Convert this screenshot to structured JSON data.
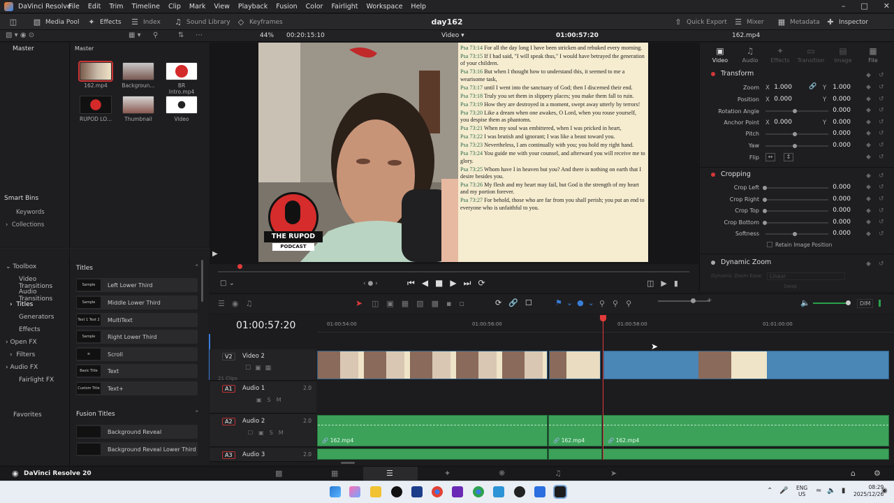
{
  "app": {
    "name": "DaVinci Resolve",
    "project": "day162",
    "version_label": "DaVinci Resolve 20"
  },
  "menu": [
    "File",
    "Edit",
    "Trim",
    "Timeline",
    "Clip",
    "Mark",
    "View",
    "Playback",
    "Fusion",
    "Color",
    "Fairlight",
    "Workspace",
    "Help"
  ],
  "toolbar": {
    "left": [
      "Media Pool",
      "Effects",
      "Index",
      "Sound Library",
      "Keyframes"
    ],
    "right": [
      "Quick Export",
      "Mixer",
      "Metadata",
      "Inspector"
    ]
  },
  "viewer_bar": {
    "zoom": "44%",
    "source_tc": "00:20:15:10",
    "mode": "Video",
    "record_tc": "01:00:57:20",
    "clip_name": "162.mp4"
  },
  "media_pool": {
    "bin_label": "Master",
    "breadcrumb": "Master",
    "clips": [
      "162.mp4",
      "Backgroun...",
      "BR Intro.mp4",
      "RUPOD LO...",
      "Thumbnail",
      "Video"
    ],
    "smart_bins_title": "Smart Bins",
    "smart_bins": [
      "Keywords",
      "Collections"
    ]
  },
  "effects_tree": [
    "Toolbox",
    "Video Transitions",
    "Audio Transitions",
    "Titles",
    "Generators",
    "Effects",
    "Open FX",
    "Filters",
    "Audio FX",
    "Fairlight FX",
    "Favorites"
  ],
  "titles": {
    "header": "Titles",
    "items": [
      {
        "label": "Left Lower Third",
        "thumb": "Sample"
      },
      {
        "label": "Middle Lower Third",
        "thumb": "Sample"
      },
      {
        "label": "MultiText",
        "thumb": "Text 1 Text 2"
      },
      {
        "label": "Right Lower Third",
        "thumb": "Sample"
      },
      {
        "label": "Scroll",
        "thumb": ""
      },
      {
        "label": "Text",
        "thumb": "Basic Title"
      },
      {
        "label": "Text+",
        "thumb": "Custom Title"
      }
    ],
    "fusion_header": "Fusion Titles",
    "fusion_items": [
      "Background Reveal",
      "Background Reveal Lower Third"
    ]
  },
  "logo": {
    "line1": "THE RUPOD",
    "line2": "PODCAST"
  },
  "scripture": [
    {
      "ref": "Psa 73:14",
      "text": "For all the day long I have been stricken and rebuked every morning."
    },
    {
      "ref": "Psa 73:15",
      "text": "If I had said, \"I will speak thus,\" I would have betrayed the generation of your children."
    },
    {
      "ref": "Psa 73:16",
      "text": "But when I thought how to understand this, it seemed to me a wearisome task,"
    },
    {
      "ref": "Psa 73:17",
      "text": "until I went into the sanctuary of God; then I discerned their end."
    },
    {
      "ref": "Psa 73:18",
      "text": "Truly you set them in slippery places; you make them fall to ruin."
    },
    {
      "ref": "Psa 73:19",
      "text": "How they are destroyed in a moment, swept away utterly by terrors!"
    },
    {
      "ref": "Psa 73:20",
      "text": "Like a dream when one awakes, O Lord, when you rouse yourself, you despise them as phantoms."
    },
    {
      "ref": "Psa 73:21",
      "text": "When my soul was embittered, when I was pricked in heart,"
    },
    {
      "ref": "Psa 73:22",
      "text": "I was brutish and ignorant; I was like a beast toward you."
    },
    {
      "ref": "Psa 73:23",
      "text": "Nevertheless, I am continually with you; you hold my right hand."
    },
    {
      "ref": "Psa 73:24",
      "text": "You guide me with your counsel, and afterward you will receive me to glory."
    },
    {
      "ref": "Psa 73:25",
      "text": "Whom have I in heaven but you? And there is nothing on earth that I desire besides you."
    },
    {
      "ref": "Psa 73:26",
      "text": "My flesh and my heart may fail, but God is the strength of my heart and my portion forever."
    },
    {
      "ref": "Psa 73:27",
      "text": "For behold, those who are far from you shall perish; you put an end to everyone who is unfaithful to you."
    }
  ],
  "inspector": {
    "tabs": [
      "Video",
      "Audio",
      "Effects",
      "Transition",
      "Image",
      "File"
    ],
    "transform": {
      "title": "Transform",
      "zoom_label": "Zoom",
      "zoom_x": "1.000",
      "zoom_y": "1.000",
      "position_label": "Position",
      "position_x": "0.000",
      "position_y": "0.000",
      "rotation_label": "Rotation Angle",
      "rotation": "0.000",
      "anchor_label": "Anchor Point",
      "anchor_x": "0.000",
      "anchor_y": "0.000",
      "pitch_label": "Pitch",
      "pitch": "0.000",
      "yaw_label": "Yaw",
      "yaw": "0.000",
      "flip_label": "Flip"
    },
    "cropping": {
      "title": "Cropping",
      "rows": [
        {
          "label": "Crop Left",
          "value": "0.000"
        },
        {
          "label": "Crop Right",
          "value": "0.000"
        },
        {
          "label": "Crop Top",
          "value": "0.000"
        },
        {
          "label": "Crop Bottom",
          "value": "0.000"
        },
        {
          "label": "Softness",
          "value": "0.000"
        }
      ],
      "retain": "Retain Image Position"
    },
    "dynamic_zoom": {
      "title": "Dynamic Zoom",
      "ease_label": "Dynamic Zoom Ease",
      "ease_value": "Linear",
      "swap": "Swap"
    }
  },
  "timeline": {
    "timecode": "01:00:57:20",
    "ruler": [
      "01:00:54:00",
      "01:00:56:00",
      "01:00:58:00",
      "01:01:00:00"
    ],
    "tracks": [
      {
        "id": "V2",
        "name": "Video 2",
        "sub": "21 Clips"
      },
      {
        "id": "A1",
        "name": "Audio 1",
        "vol": "2.0"
      },
      {
        "id": "A2",
        "name": "Audio 2",
        "vol": "2.0"
      },
      {
        "id": "A3",
        "name": "Audio 3",
        "vol": "2.0"
      }
    ],
    "audio_clips": [
      "162.mp4",
      "162.mp4",
      "162.mp4"
    ],
    "dim": "DIM"
  },
  "taskbar": {
    "lang1": "ENG",
    "lang2": "US",
    "time": "08:29",
    "date": "2025/12/26"
  }
}
